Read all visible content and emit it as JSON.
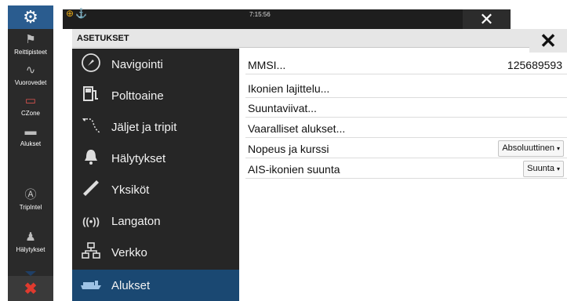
{
  "statusbar": {
    "time": "7:15:56",
    "indicators": "⊕⚓",
    "settings_icon": "gear-icon",
    "close_glyph": "✕"
  },
  "rail": {
    "items": [
      {
        "label": "Reittipisteet",
        "icon": "flag-icon",
        "glyph": "⚑"
      },
      {
        "label": "Vuorovedet",
        "icon": "tide-wave-icon",
        "glyph": "∿"
      },
      {
        "label": "CZone",
        "icon": "czone-icon",
        "glyph": "▭"
      },
      {
        "label": "Alukset",
        "icon": "vessels-icon",
        "glyph": "▬"
      },
      {
        "label": "TripIntel",
        "icon": "tripintel-icon",
        "glyph": "Ⓐ"
      },
      {
        "label": "Hälytykset",
        "icon": "bell-icon",
        "glyph": "🔔"
      }
    ],
    "bottom_glyph": "✖",
    "bottom_icon": "close-x-icon"
  },
  "dialog": {
    "title": "ASETUKSET",
    "close_glyph": "✕"
  },
  "menu": {
    "items": [
      {
        "label": "Navigointi",
        "icon": "compass-icon",
        "glyph": "◴"
      },
      {
        "label": "Polttoaine",
        "icon": "fuel-pump-icon",
        "glyph": "⛽"
      },
      {
        "label": "Jäljet ja tripit",
        "icon": "tracks-icon",
        "glyph": "➰"
      },
      {
        "label": "Hälytykset",
        "icon": "bell-icon",
        "glyph": "🔔"
      },
      {
        "label": "Yksiköt",
        "icon": "ruler-icon",
        "glyph": "📏"
      },
      {
        "label": "Langaton",
        "icon": "wireless-icon",
        "glyph": "((•))"
      },
      {
        "label": "Verkko",
        "icon": "network-icon",
        "glyph": "🖧"
      },
      {
        "label": "Alukset",
        "icon": "vessels-icon",
        "glyph": "▬"
      }
    ],
    "active_index": 7
  },
  "settings": {
    "rows": [
      {
        "label": "MMSI...",
        "value": "125689593"
      },
      {
        "label": "Ikonien lajittelu..."
      },
      {
        "label": "Suuntaviivat..."
      },
      {
        "label": "Vaaralliset alukset..."
      },
      {
        "label": "Nopeus ja kurssi",
        "dropdown": "Absoluuttinen"
      },
      {
        "label": "AIS-ikonien suunta",
        "dropdown": "Suunta"
      }
    ]
  },
  "colors": {
    "accent": "#1a4872",
    "rail_bg": "#2a2a2a",
    "menu_bg": "#262626",
    "gear_tab": "#2a5c8f",
    "alert": "#e03a2e"
  }
}
